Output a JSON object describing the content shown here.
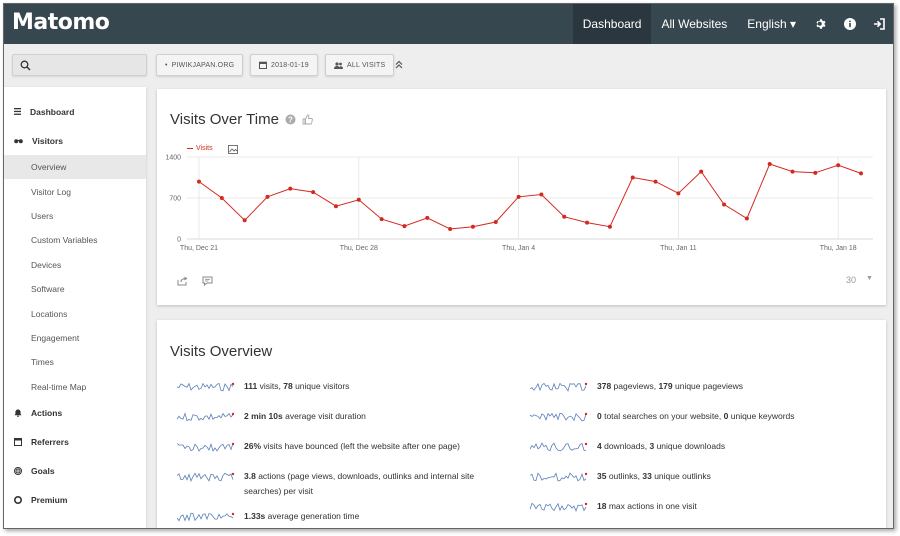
{
  "app": {
    "logo": "Matomo"
  },
  "topnav": {
    "dashboard": "Dashboard",
    "all_websites": "All Websites",
    "language": "English ▾"
  },
  "controls": {
    "site": "PIWIKJAPAN.ORG",
    "date": "2018-01-19",
    "segment": "ALL VISITS"
  },
  "sidebar": {
    "dashboard": "Dashboard",
    "visitors": "Visitors",
    "visitor_items": [
      "Overview",
      "Visitor Log",
      "Users",
      "Custom Variables",
      "Devices",
      "Software",
      "Locations",
      "Engagement",
      "Times",
      "Real-time Map"
    ],
    "actions": "Actions",
    "referrers": "Referrers",
    "goals": "Goals",
    "premium": "Premium"
  },
  "visits_chart": {
    "title": "Visits Over Time",
    "period": "30"
  },
  "chart_data": {
    "type": "line",
    "series": [
      {
        "name": "Visits",
        "color": "#d4291f",
        "values": [
          980,
          700,
          320,
          720,
          860,
          800,
          560,
          670,
          340,
          220,
          360,
          170,
          210,
          290,
          720,
          760,
          380,
          280,
          210,
          1050,
          980,
          780,
          1150,
          590,
          350,
          1280,
          1150,
          1130,
          1260,
          1120
        ]
      }
    ],
    "x_tick_labels": [
      "Thu, Dec 21",
      "Thu, Dec 28",
      "Thu, Jan 4",
      "Thu, Jan 11",
      "Thu, Jan 18"
    ],
    "x_tick_indices": [
      0,
      7,
      14,
      21,
      28
    ],
    "y_ticks": [
      0,
      700,
      1400
    ],
    "ylim": [
      0,
      1400
    ],
    "grid": true,
    "legend": "top-left"
  },
  "overview": {
    "title": "Visits Overview",
    "left": [
      {
        "n1": "111",
        "t1": " visits, ",
        "n2": "78",
        "t2": " unique visitors"
      },
      {
        "n1": "2 min 10s",
        "t1": " average visit duration",
        "n2": "",
        "t2": ""
      },
      {
        "n1": "26%",
        "t1": " visits have bounced (left the website after one page)",
        "n2": "",
        "t2": ""
      },
      {
        "n1": "3.8",
        "t1": " actions (page views, downloads, outlinks and internal site searches) per visit",
        "n2": "",
        "t2": ""
      },
      {
        "n1": "1.33s",
        "t1": " average generation time",
        "n2": "",
        "t2": ""
      }
    ],
    "right": [
      {
        "n1": "378",
        "t1": " pageviews, ",
        "n2": "179",
        "t2": " unique pageviews"
      },
      {
        "n1": "0",
        "t1": " total searches on your website, ",
        "n2": "0",
        "t2": " unique keywords"
      },
      {
        "n1": "4",
        "t1": " downloads, ",
        "n2": "3",
        "t2": " unique downloads"
      },
      {
        "n1": "35",
        "t1": " outlinks, ",
        "n2": "33",
        "t2": " unique outlinks"
      },
      {
        "n1": "18",
        "t1": " max actions in one visit",
        "n2": "",
        "t2": ""
      }
    ]
  }
}
